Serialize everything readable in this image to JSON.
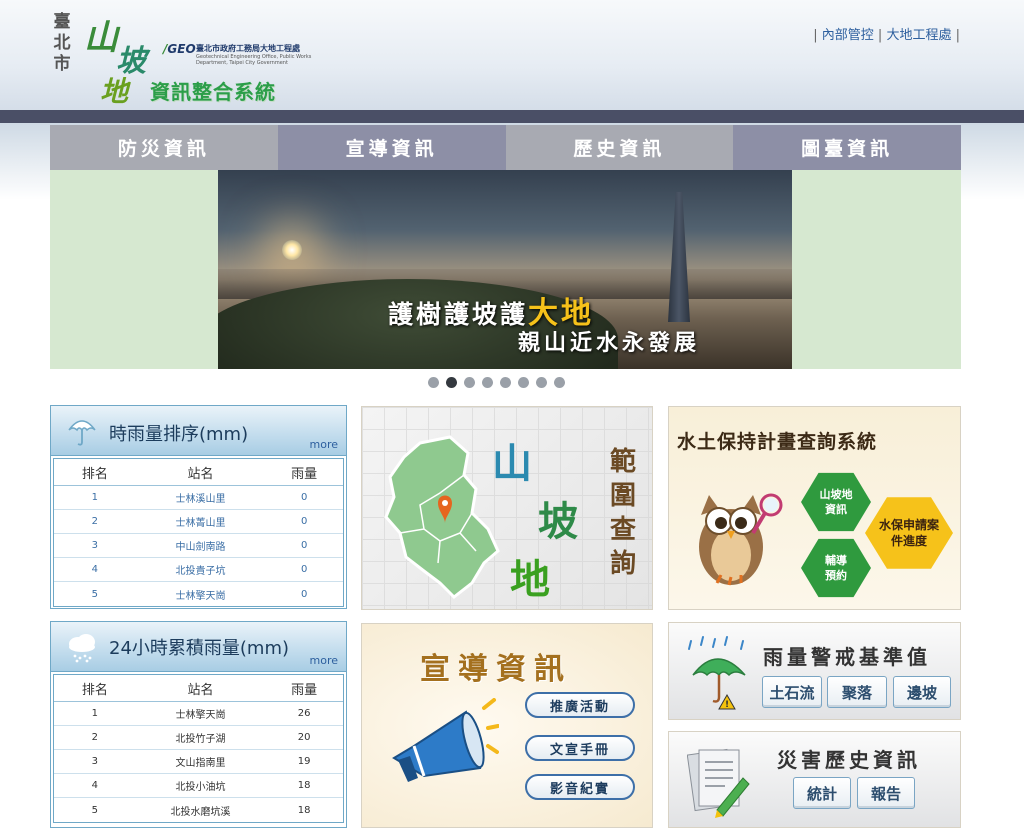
{
  "header": {
    "logo_city": "臺北市",
    "logo_shan": "山",
    "logo_po": "坡",
    "logo_di": "地",
    "logo_sys": "資訊整合系統",
    "geo_mark": "GEO",
    "geo_org": "臺北市政府工務局大地工程處",
    "geo_org_en": "Geotechnical Engineering Office, Public Works Department, Taipei City Government",
    "links": [
      "內部管控",
      "大地工程處"
    ],
    "separator": "|"
  },
  "nav": {
    "items": [
      "防災資訊",
      "宣導資訊",
      "歷史資訊",
      "圖臺資訊"
    ]
  },
  "banner": {
    "line1_a": "護樹護坡護",
    "line1_b": "大地",
    "line2": "親山近水永發展",
    "slide_count": 8,
    "active_slide": 2
  },
  "rain_hourly": {
    "title": "時雨量排序(mm)",
    "more": "more",
    "headers": [
      "排名",
      "站名",
      "雨量"
    ],
    "rows": [
      [
        "1",
        "士林溪山里",
        "0"
      ],
      [
        "2",
        "士林菁山里",
        "0"
      ],
      [
        "3",
        "中山劍南路",
        "0"
      ],
      [
        "4",
        "北投貴子坑",
        "0"
      ],
      [
        "5",
        "士林擎天崗",
        "0"
      ]
    ]
  },
  "rain_24h": {
    "title": "24小時累積雨量(mm)",
    "more": "more",
    "headers": [
      "排名",
      "站名",
      "雨量"
    ],
    "rows": [
      [
        "1",
        "士林擎天崗",
        "26"
      ],
      [
        "2",
        "北投竹子湖",
        "20"
      ],
      [
        "3",
        "文山指南里",
        "19"
      ],
      [
        "4",
        "北投小油坑",
        "18"
      ],
      [
        "5",
        "北投水磨坑溪",
        "18"
      ]
    ]
  },
  "map_tile": {
    "c1": "山",
    "c2": "坡",
    "c3": "地",
    "scope": [
      "範",
      "圍",
      "查",
      "詢"
    ]
  },
  "water_tile": {
    "title": "水土保持計畫查詢系統",
    "hex1": "山坡地資訊",
    "hex2": "水保申請案件進度",
    "hex3": "輔導預約"
  },
  "promo_tile": {
    "title": "宣導資訊",
    "buttons": [
      "推廣活動",
      "文宣手冊",
      "影音紀實"
    ]
  },
  "rain_alert_tile": {
    "title": "雨量警戒基準值",
    "buttons": [
      "土石流",
      "聚落",
      "邊坡"
    ]
  },
  "history_tile": {
    "title": "災害歷史資訊",
    "buttons": [
      "統計",
      "報告"
    ]
  },
  "colors": {
    "nav_light": "#a8aab2",
    "nav_dark": "#8d8fa6",
    "header_bar": "#4a4f66",
    "link_blue": "#2d5f9e",
    "hex_green": "#2f9a3e",
    "hex_yellow": "#f6c21a"
  }
}
